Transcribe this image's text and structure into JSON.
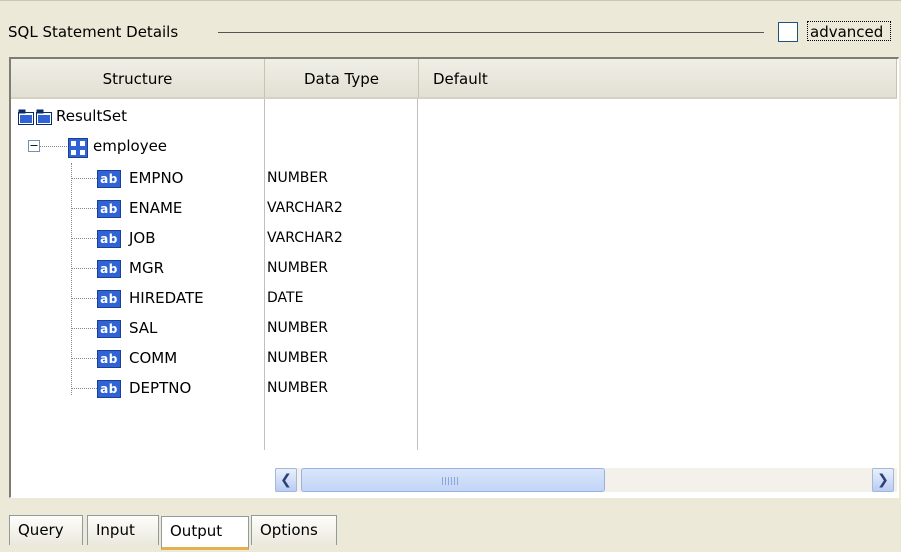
{
  "group": {
    "title": "SQL Statement Details",
    "advanced_label": "advanced",
    "advanced_checked": false
  },
  "table": {
    "columns": [
      "Structure",
      "Data Type",
      "Default"
    ],
    "root": {
      "label": "ResultSet",
      "icon": "folder-icon"
    },
    "node": {
      "label": "employee",
      "icon": "table-icon",
      "expanded": true
    },
    "fields": [
      {
        "name": "EMPNO",
        "type": "NUMBER"
      },
      {
        "name": "ENAME",
        "type": "VARCHAR2"
      },
      {
        "name": "JOB",
        "type": "VARCHAR2"
      },
      {
        "name": "MGR",
        "type": "NUMBER"
      },
      {
        "name": "HIREDATE",
        "type": "DATE"
      },
      {
        "name": "SAL",
        "type": "NUMBER"
      },
      {
        "name": "COMM",
        "type": "NUMBER"
      },
      {
        "name": "DEPTNO",
        "type": "NUMBER"
      }
    ],
    "field_icon_text": "ab"
  },
  "tabs": [
    {
      "label": "Query",
      "active": false
    },
    {
      "label": "Input",
      "active": false
    },
    {
      "label": "Output",
      "active": true
    },
    {
      "label": "Options",
      "active": false
    }
  ],
  "colors": {
    "icon_blue": "#2f63d6",
    "active_tab_accent": "#e6b14a",
    "background": "#ece9d8"
  }
}
